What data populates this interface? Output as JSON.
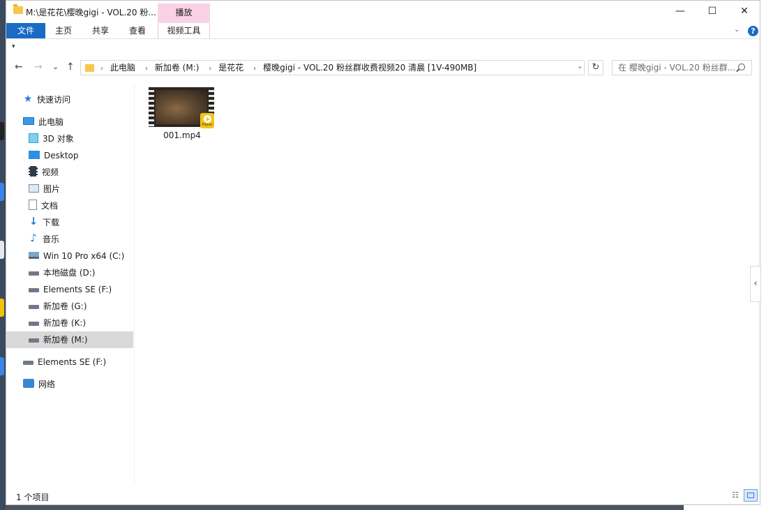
{
  "window": {
    "title": "M:\\是花花\\樱晚gigi - VOL.20 粉..."
  },
  "ribbon": {
    "context_header": "播放",
    "tabs": [
      "文件",
      "主页",
      "共享",
      "查看",
      "视频工具"
    ],
    "help_glyph": "?"
  },
  "window_controls": {
    "minimize": "—",
    "maximize": "☐",
    "close": "✕"
  },
  "navigation": {
    "back": "←",
    "forward": "→",
    "recent": "⌄",
    "up": "↑",
    "breadcrumb": [
      "此电脑",
      "新加卷 (M:)",
      "是花花",
      "樱晚gigi - VOL.20 粉丝群收费视频20 清晨 [1V-490MB]"
    ],
    "separator": "›",
    "dropdown": "⌄",
    "refresh": "↻"
  },
  "search": {
    "placeholder": "在 樱晚gigi - VOL.20 粉丝群..."
  },
  "sidebar": {
    "quick_access": "快速访问",
    "this_pc": "此电脑",
    "items": [
      {
        "label": "3D 对象",
        "icon": "3d-objects-icon"
      },
      {
        "label": "Desktop",
        "icon": "desktop-icon"
      },
      {
        "label": "视频",
        "icon": "videos-icon"
      },
      {
        "label": "图片",
        "icon": "pictures-icon"
      },
      {
        "label": "文档",
        "icon": "documents-icon"
      },
      {
        "label": "下载",
        "icon": "downloads-icon"
      },
      {
        "label": "音乐",
        "icon": "music-icon"
      },
      {
        "label": "Win 10 Pro x64 (C:)",
        "icon": "windows-drive-icon"
      },
      {
        "label": "本地磁盘 (D:)",
        "icon": "drive-icon"
      },
      {
        "label": "Elements SE (F:)",
        "icon": "drive-icon"
      },
      {
        "label": "新加卷 (G:)",
        "icon": "drive-icon"
      },
      {
        "label": "新加卷 (K:)",
        "icon": "drive-icon"
      },
      {
        "label": "新加卷 (M:)",
        "icon": "drive-icon",
        "selected": true
      }
    ],
    "external_drive": "Elements SE (F:)",
    "network": "网络"
  },
  "files": [
    {
      "name": "001.mp4",
      "badge": "Player"
    }
  ],
  "status": {
    "item_count": "1 个项目"
  },
  "colors": {
    "accent": "#1a6bc4",
    "context_tab": "#f9d2e6",
    "selected_nav": "#d9d9d9"
  }
}
